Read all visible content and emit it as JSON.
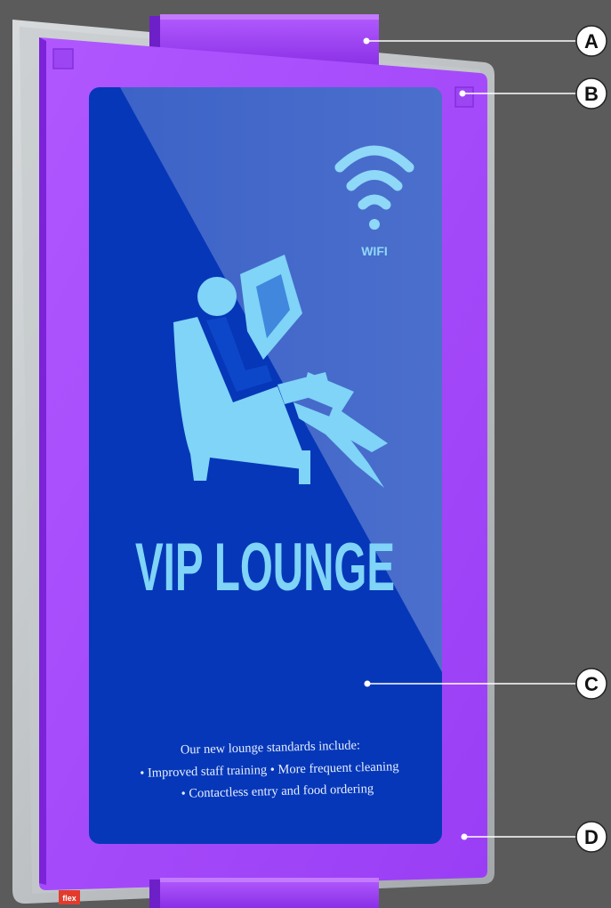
{
  "sign": {
    "wifi_label": "WIFI",
    "title": "VIP LOUNGE",
    "body_lines": [
      "Our new lounge standards include:",
      "• Improved staff training • More frequent cleaning",
      "• Contactless entry and food ordering"
    ],
    "brand_mark": "flex"
  },
  "callouts": [
    {
      "letter": "A"
    },
    {
      "letter": "B"
    },
    {
      "letter": "C"
    },
    {
      "letter": "D"
    }
  ],
  "colors": {
    "background": "#5b5b5b",
    "frame": "#a64dff",
    "panel": "#0637b8",
    "graphic": "#7fd4f7",
    "glass": "#d9dde0"
  },
  "icons": [
    "wifi-icon",
    "reading-person-icon"
  ]
}
